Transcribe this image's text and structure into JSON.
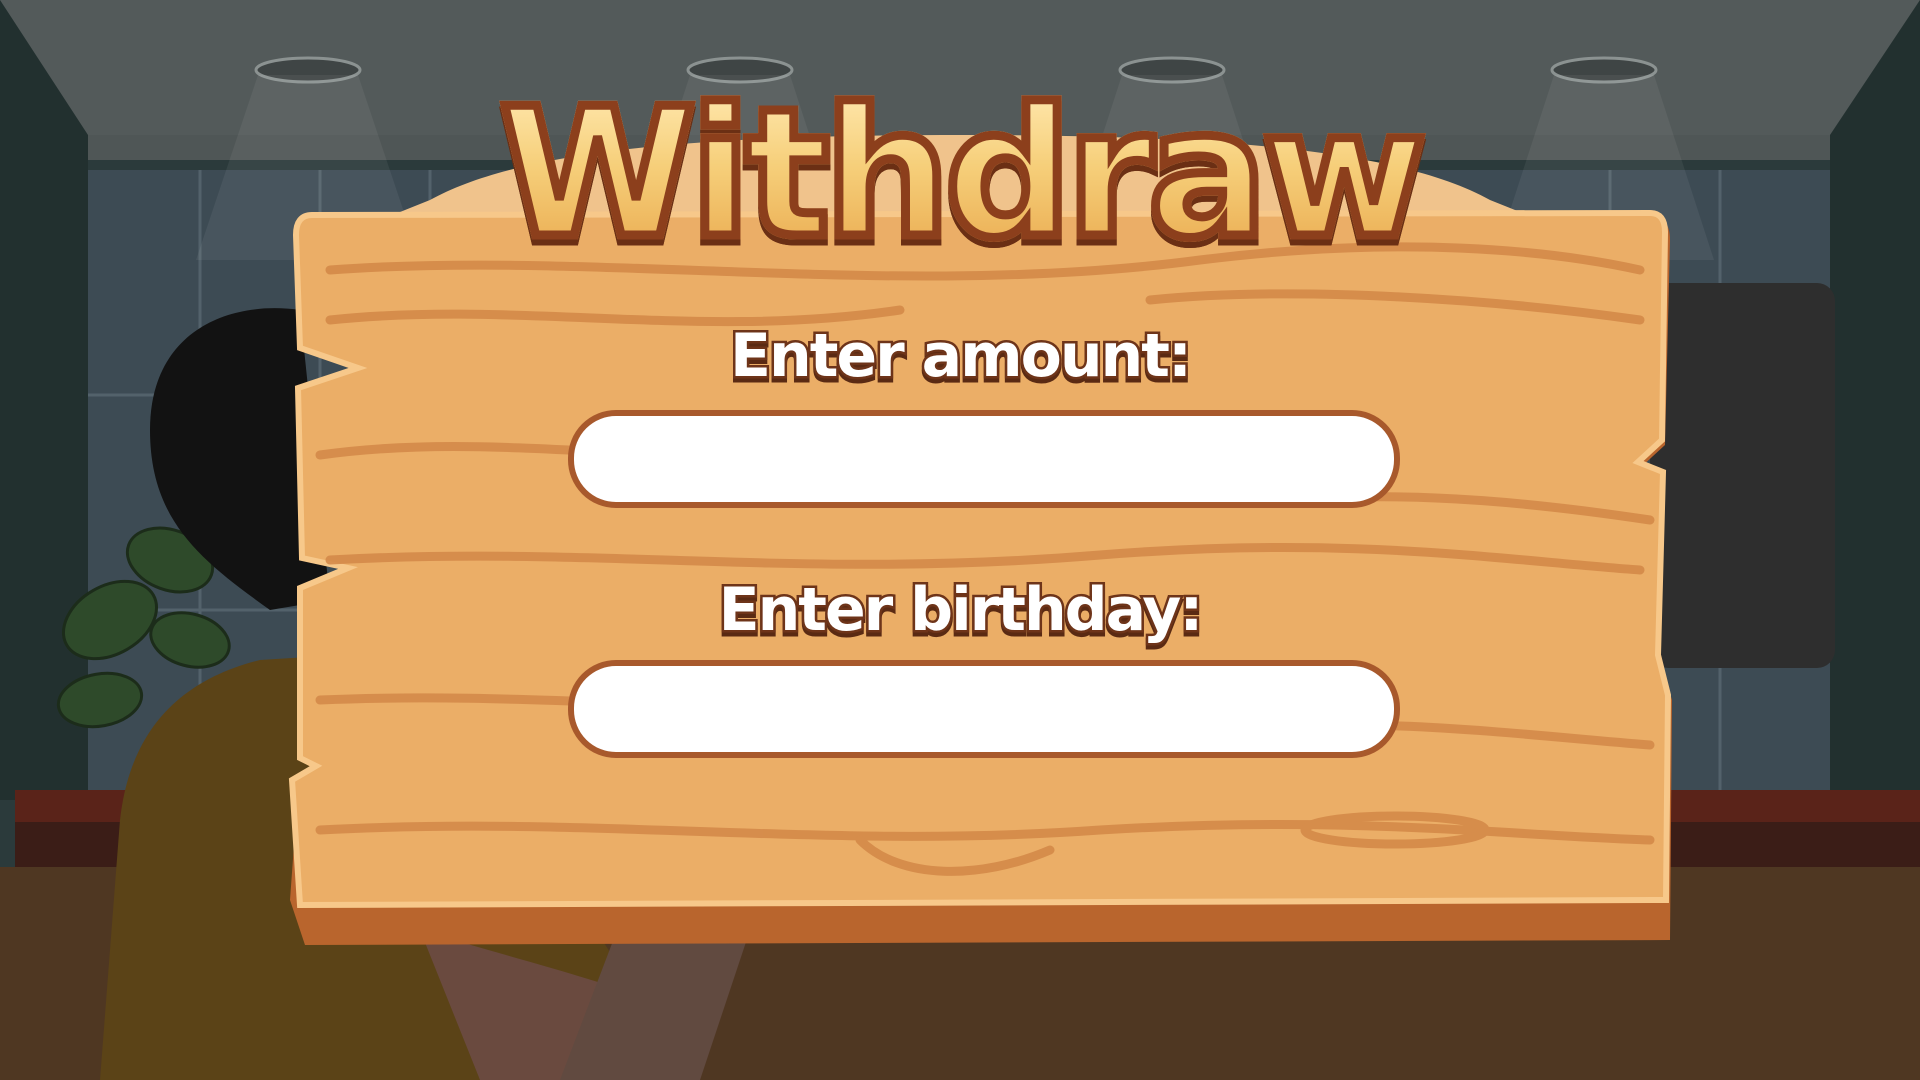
{
  "title": "Withdraw",
  "form": {
    "amount_label": "Enter amount:",
    "amount_value": "",
    "birthday_label": "Enter birthday:",
    "birthday_value": ""
  },
  "colors": {
    "wood_light": "#ebae67",
    "wood_grain": "#d48a49",
    "wood_edge": "#b9652d",
    "title_fill": "#f6cf7a",
    "title_outline": "#8c3f1c",
    "input_border": "#a8592c"
  }
}
